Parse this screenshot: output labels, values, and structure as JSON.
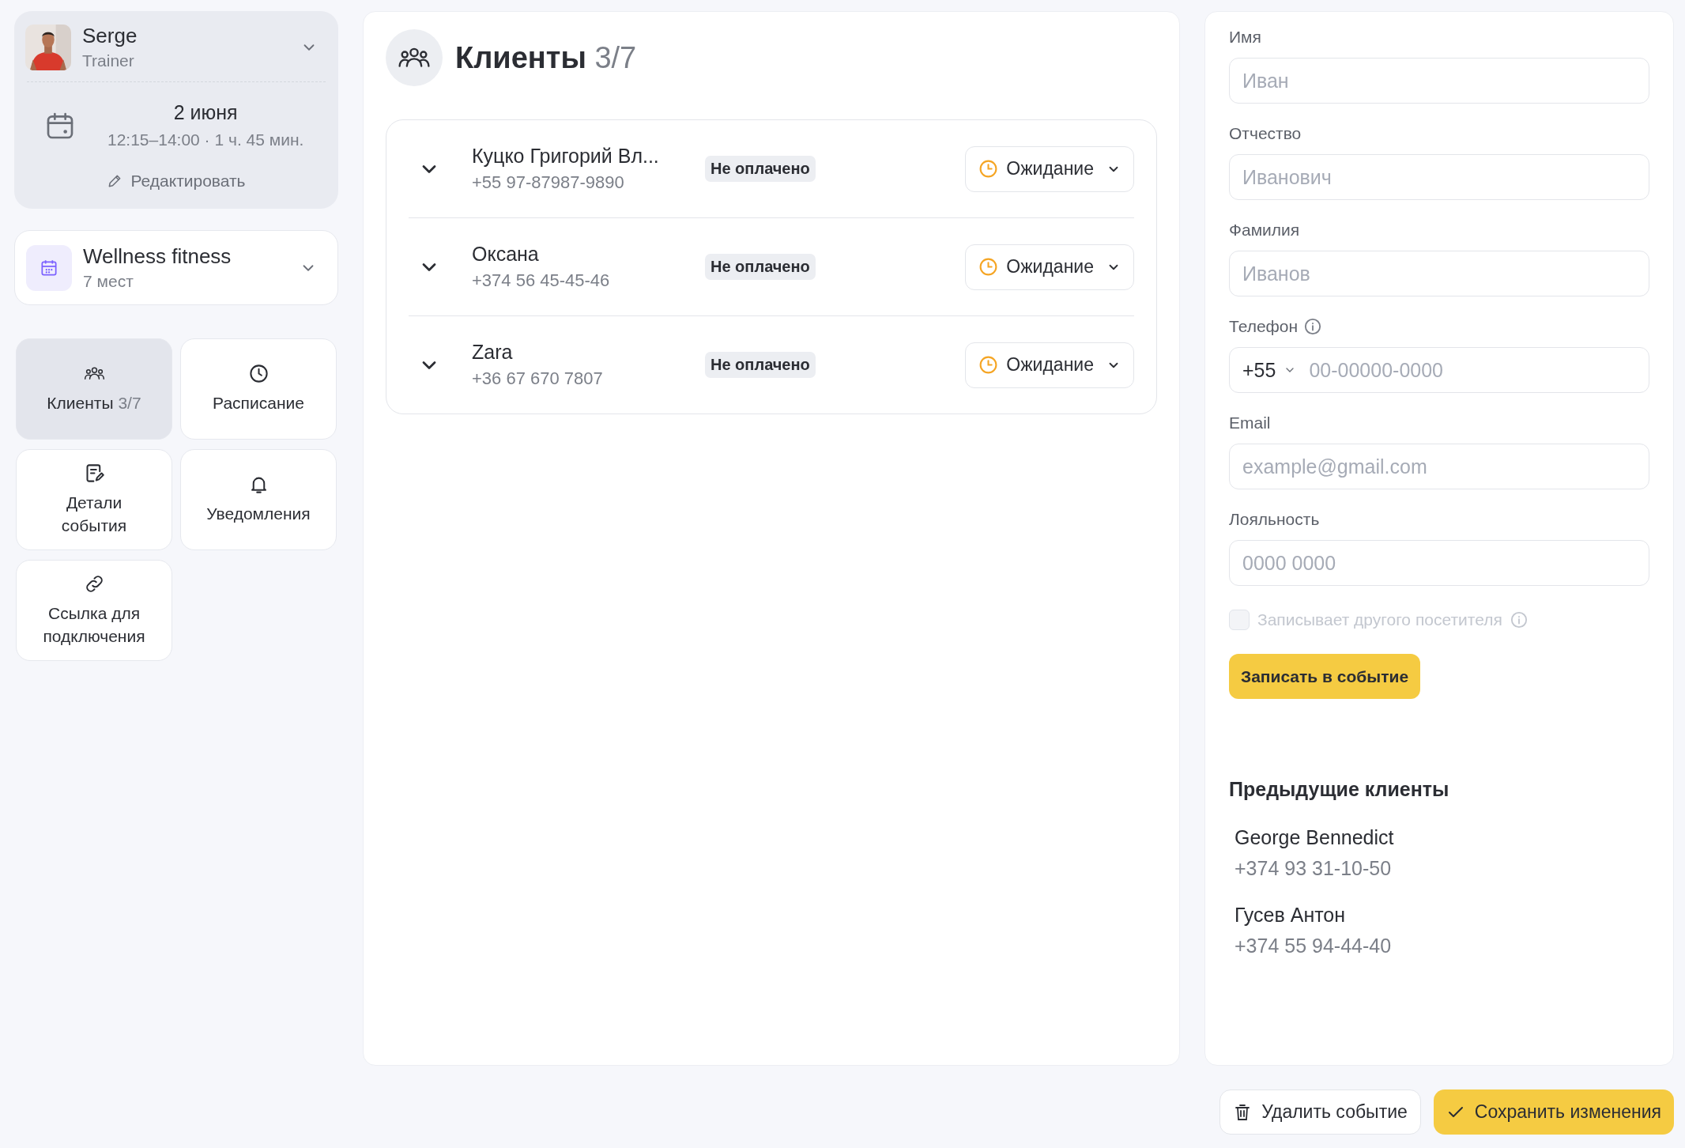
{
  "profile": {
    "name": "Serge",
    "role": "Trainer"
  },
  "event": {
    "date": "2 июня",
    "time": "12:15–14:00 · 1 ч. 45 мин.",
    "edit_link": "Редактировать"
  },
  "venue": {
    "name": "Wellness fitness",
    "capacity": "7 мест"
  },
  "nav": [
    {
      "kind": "clients",
      "label": "Клиенты",
      "count": "3/7",
      "selected": true
    },
    {
      "kind": "schedule",
      "label": "Расписание",
      "selected": false
    },
    {
      "kind": "details",
      "label": "Детали события",
      "selected": false
    },
    {
      "kind": "notifications",
      "label": "Уведомления",
      "selected": false
    },
    {
      "kind": "link",
      "label": "Ссылка для подключения",
      "selected": false
    }
  ],
  "clients_panel": {
    "title": "Клиенты",
    "count": "3/7",
    "clients": [
      {
        "name": "Куцко Григорий Вл...",
        "phone": "+55 97-87987-9890",
        "payment": "Не оплачено",
        "status": "Ожидание"
      },
      {
        "name": "Оксана",
        "phone": "+374 56 45-45-46",
        "payment": "Не оплачено",
        "status": "Ожидание"
      },
      {
        "name": "Zara",
        "phone": "+36 67 670 7807",
        "payment": "Не оплачено",
        "status": "Ожидание"
      }
    ]
  },
  "form": {
    "fields": [
      {
        "kind": "text",
        "label": "Имя",
        "placeholder": "Иван"
      },
      {
        "kind": "text",
        "label": "Отчество",
        "placeholder": "Иванович"
      },
      {
        "kind": "text",
        "label": "Фамилия",
        "placeholder": "Иванов"
      },
      {
        "kind": "phone",
        "label": "Телефон",
        "info": true,
        "code": "+55",
        "placeholder": "00-00000-0000"
      },
      {
        "kind": "text",
        "label": "Email",
        "placeholder": "example@gmail.com"
      },
      {
        "kind": "text",
        "label": "Лояльность",
        "placeholder": "0000 0000"
      }
    ],
    "checkbox": {
      "label": "Записывает другого посетителя",
      "checked": false,
      "disabled": true,
      "info": true
    },
    "submit": "Записать в событие"
  },
  "previous_clients": {
    "title": "Предыдущие клиенты",
    "clients": [
      {
        "name": "George Bennedict",
        "phone": "+374 93 31-10-50"
      },
      {
        "name": "Гусев Антон",
        "phone": "+374 55 94-44-40"
      }
    ]
  },
  "actions": {
    "delete": "Удалить событие",
    "save": "Сохранить изменения"
  }
}
